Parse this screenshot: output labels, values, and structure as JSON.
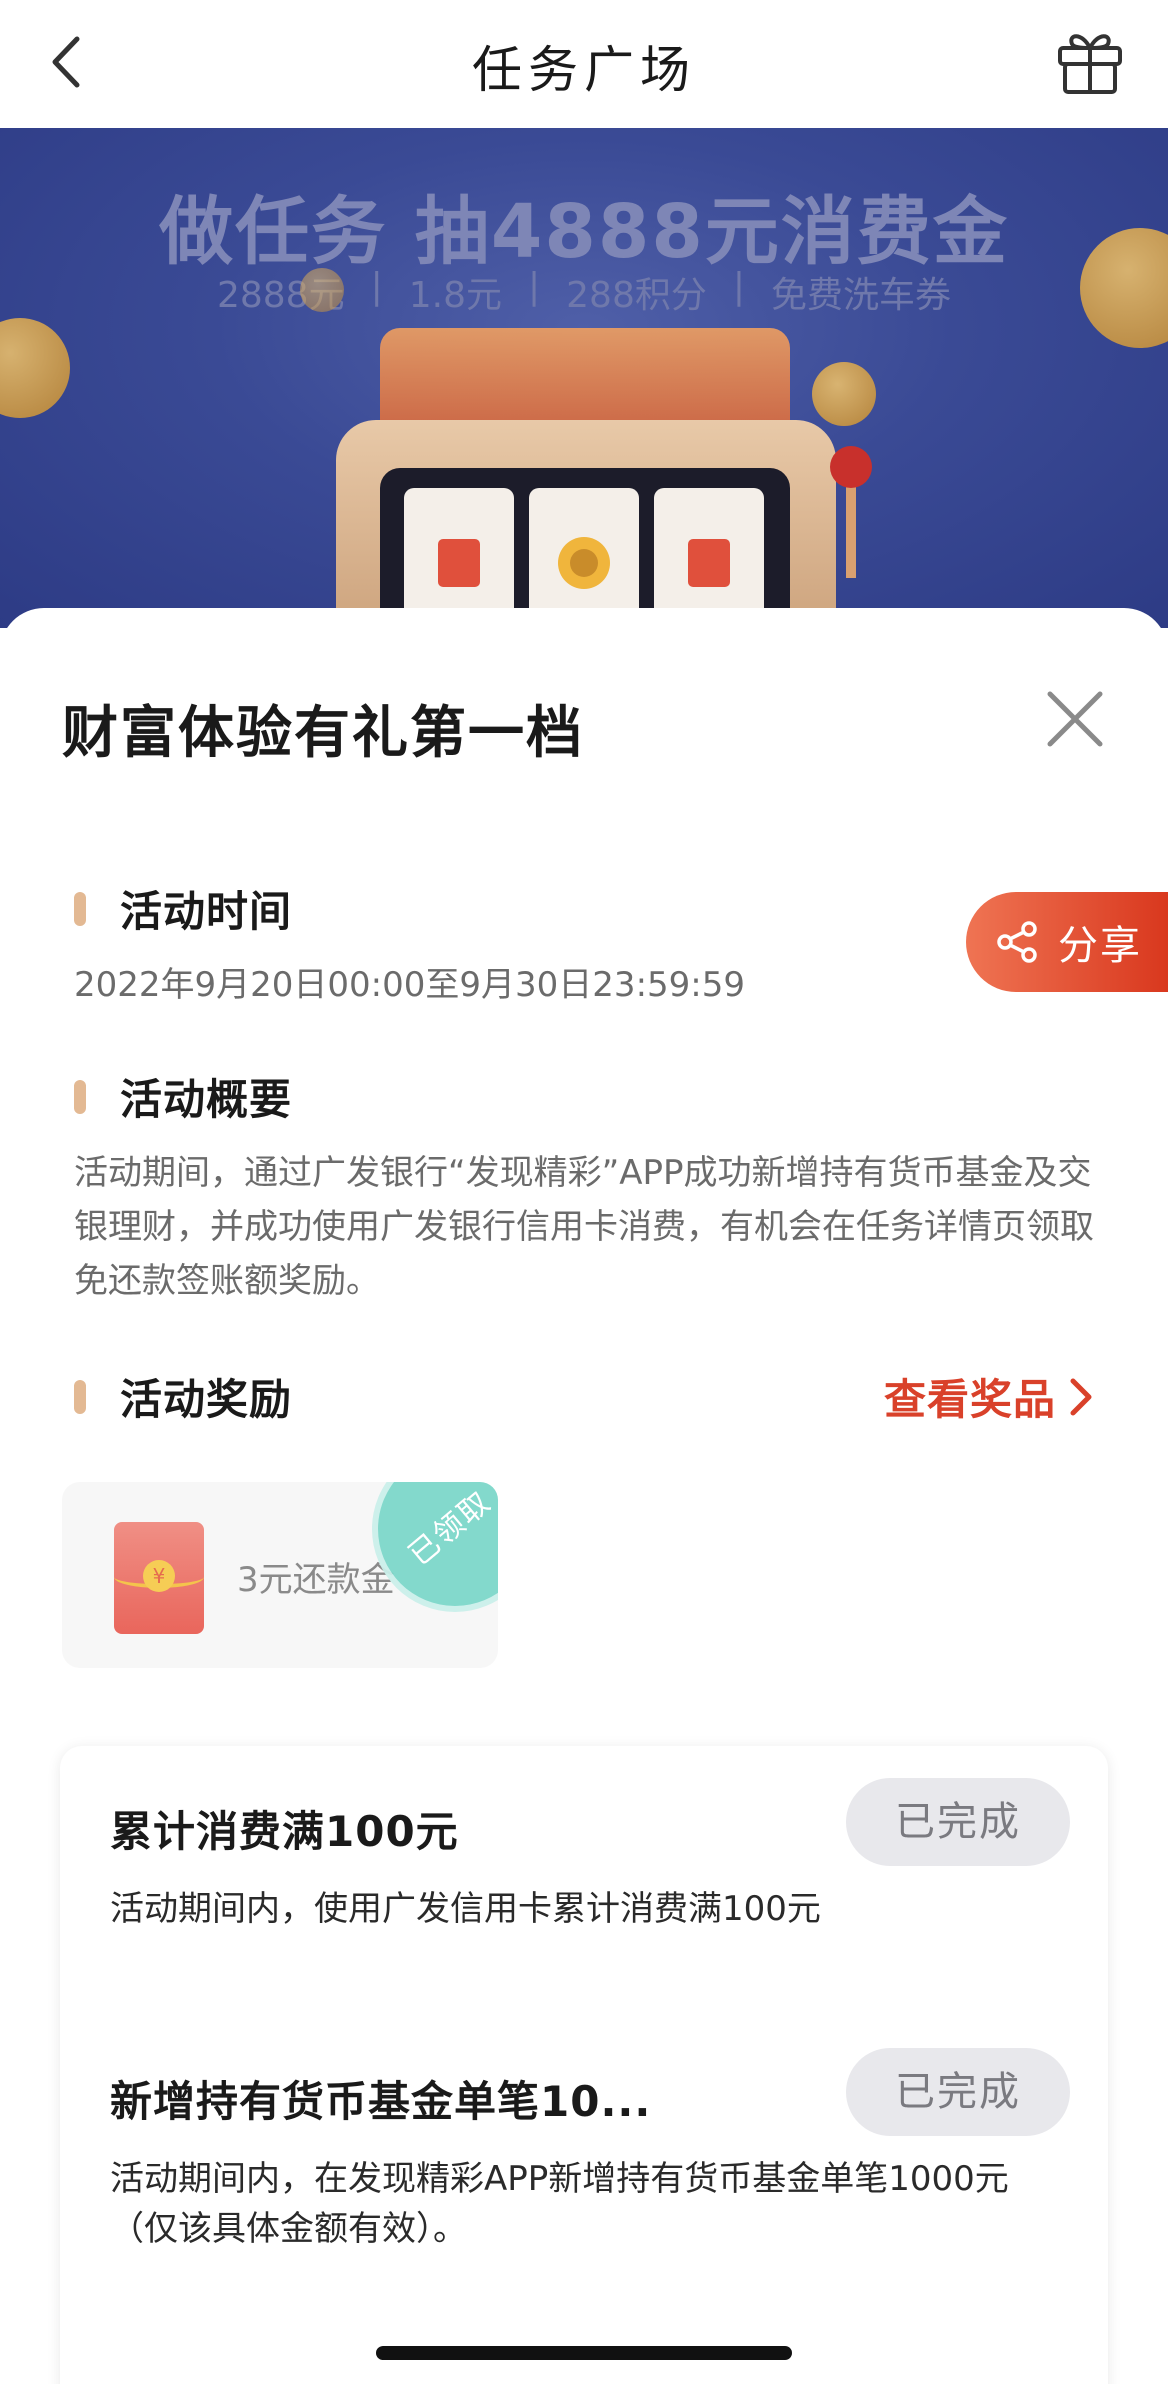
{
  "nav": {
    "title": "任务广场",
    "back_icon": "chevron-left-icon",
    "gift_icon": "gift-icon"
  },
  "banner": {
    "headline": "做任务 抽4888元消费金",
    "prizes": [
      "2888元",
      "1.8元",
      "288积分",
      "免费洗车券"
    ]
  },
  "sheet": {
    "title": "财富体验有礼第一档",
    "close_icon": "close-icon",
    "share": {
      "label": "分享",
      "icon": "share-icon"
    },
    "time": {
      "heading": "活动时间",
      "text": "2022年9月20日00:00至9月30日23:59:59"
    },
    "summary": {
      "heading": "活动概要",
      "text": "活动期间，通过广发银行“发现精彩”APP成功新增持有货币基金及交银理财，并成功使用广发银行信用卡消费，有机会在任务详情页领取免还款签账额奖励。"
    },
    "rewards": {
      "heading": "活动奖励",
      "view_prize": "查看奖品",
      "items": [
        {
          "label": "3元还款金",
          "status": "已领取",
          "icon": "red-packet-icon"
        }
      ]
    },
    "tasks": [
      {
        "title": "累计消费满100元",
        "status": "已完成",
        "desc": "活动期间内，使用广发信用卡累计消费满100元"
      },
      {
        "title": "新增持有货币基金单笔10...",
        "status": "已完成",
        "desc": "活动期间内，在发现精彩APP新增持有货币基金单笔1000元（仅该具体金额有效）。"
      }
    ]
  },
  "colors": {
    "accent_red": "#d9412a",
    "share_gradient_start": "#ef7453",
    "share_gradient_end": "#d9381e",
    "section_bar": "#e3b993",
    "claimed_stamp": "#6ed4c4",
    "banner_bg": "#3a4a95"
  }
}
